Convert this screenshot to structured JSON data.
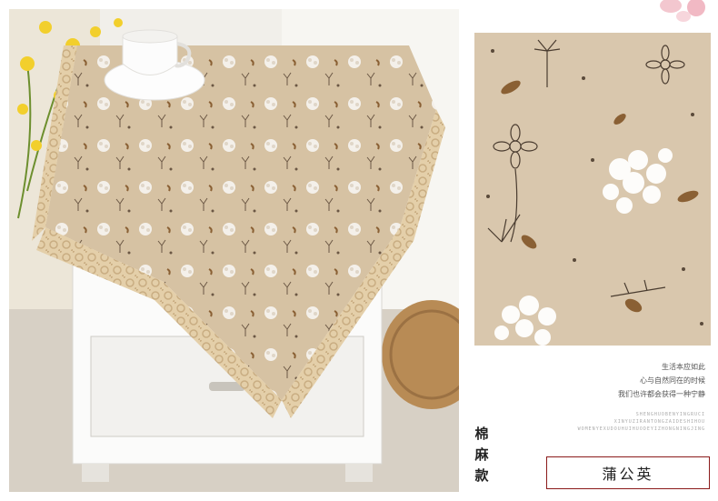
{
  "poem": {
    "line1": "生活本应如此",
    "line2": "心与自然同在的时候",
    "line3": "我们也许都会获得一种宁静"
  },
  "pinyin": {
    "line1": "SHENGHUOBENYINGRUCI",
    "line2": "XINYUZIRANTONGZAIDESHIHOU",
    "line3": "WOMENYEXUDOUHUIHUODEYIZHONGNINGJING"
  },
  "material_label": "棉麻款",
  "pattern_name": "蒲公英",
  "colors": {
    "fabric": "#d9c7ad",
    "lace": "#e4cfa9",
    "border": "#8b1a1a",
    "dandelion": "#ffffff",
    "sprig": "#5a4a3a",
    "leaf": "#8a6034"
  },
  "icons": {
    "petals": "peach-blossom-petals-icon",
    "dandelion": "dandelion-print-icon",
    "flower": "line-flower-print-icon"
  }
}
